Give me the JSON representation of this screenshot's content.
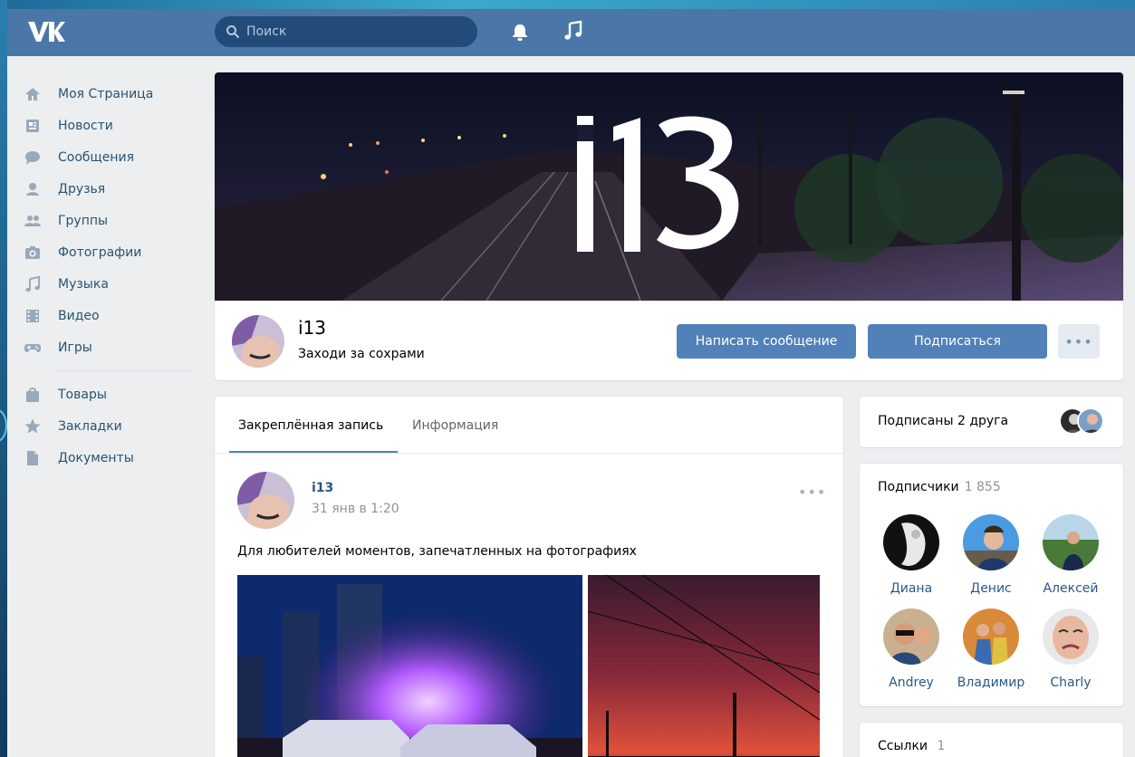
{
  "header": {
    "search_placeholder": "Поиск"
  },
  "menu": {
    "items": [
      {
        "label": "Моя Страница",
        "icon": "home-icon"
      },
      {
        "label": "Новости",
        "icon": "news-icon"
      },
      {
        "label": "Сообщения",
        "icon": "messages-icon"
      },
      {
        "label": "Друзья",
        "icon": "friends-icon"
      },
      {
        "label": "Группы",
        "icon": "groups-icon"
      },
      {
        "label": "Фотографии",
        "icon": "camera-icon"
      },
      {
        "label": "Музыка",
        "icon": "music-icon"
      },
      {
        "label": "Видео",
        "icon": "video-icon"
      },
      {
        "label": "Игры",
        "icon": "gamepad-icon"
      }
    ],
    "items2": [
      {
        "label": "Товары",
        "icon": "bag-icon"
      },
      {
        "label": "Закладки",
        "icon": "star-icon"
      },
      {
        "label": "Документы",
        "icon": "document-icon"
      }
    ]
  },
  "group": {
    "cover_text": "i13",
    "name": "i13",
    "status": "Заходи за сохрами",
    "message_button": "Написать сообщение",
    "subscribe_button": "Подписаться",
    "more_button": "•••"
  },
  "wall": {
    "tab_pinned": "Закреплённая запись",
    "tab_info": "Информация",
    "post": {
      "author": "i13",
      "date": "31 янв в 1:20",
      "text": "Для любителей моментов, запечатленных на фотографиях",
      "more": "•••"
    }
  },
  "sidebar": {
    "friends_text": "Подписаны 2 друга",
    "subscribers_title": "Подписчики",
    "subscribers_count": "1 855",
    "subscribers": [
      {
        "name": "Диана"
      },
      {
        "name": "Денис"
      },
      {
        "name": "Алексей"
      },
      {
        "name": "Andrey"
      },
      {
        "name": "Владимир"
      },
      {
        "name": "Charly"
      }
    ],
    "links_title": "Ссылки",
    "links_count": "1"
  },
  "colors": {
    "header": "#4a76a8",
    "accent": "#5181b8",
    "link": "#2a5885",
    "background": "#edeef0"
  }
}
